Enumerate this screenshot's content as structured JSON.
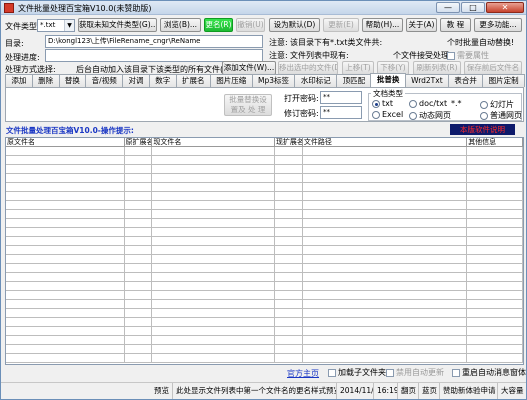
{
  "window": {
    "title": "文件批量处理百宝箱V10.0(未赞助版)",
    "min_glyph": "—",
    "max_glyph": "□",
    "close_glyph": "✕"
  },
  "toolbar": {
    "file_type_label": "文件类型",
    "file_type_value": "*.txt",
    "get_unknown_type_button": "获取未知文件类型(G)...",
    "browse_button": "浏览(B)...",
    "rename_button": "更名(R)",
    "undo_button": "撤销(U)",
    "set_default_button": "设为默认(D)",
    "update_button": "更新(E)",
    "help_button": "帮助(H)...",
    "about_button": "关于(A)",
    "tutorial_button": "教 程",
    "more_button": "更多功能..."
  },
  "dir": {
    "label": "目录:",
    "path": "D:\\kongl123\\上传\\FileRename_cngr\\ReName",
    "progress_label": "处理进度:",
    "note1_label": "注意:",
    "note1_text": "该目录下有*.txt类文件共:",
    "note2_label": "注意:",
    "note2_text": "文件列表中现有:",
    "auto_replace_text": "个时批量自动替换!",
    "files_accepted_text": "个文件接受处理。",
    "keep_attr_label": "需要属性"
  },
  "mode": {
    "label": "处理方式选择:",
    "auto_join_text": "后台自动加入该目录下该类型的所有文件(Y)",
    "add_file_button": "添加文件(W)...",
    "remove_selected_button": "移出选中的文件(D)",
    "move_up_button": "上移(T)",
    "move_down_button": "下移(Y)",
    "refresh_list_button": "刷新列表(R)",
    "save_list_button": "保存前后文件名"
  },
  "tabs": [
    {
      "label": "添加"
    },
    {
      "label": "删除"
    },
    {
      "label": "替换"
    },
    {
      "label": "音/视频"
    },
    {
      "label": "对调"
    },
    {
      "label": "数字"
    },
    {
      "label": "扩展名"
    },
    {
      "label": "图片压缩"
    },
    {
      "label": "Mp3标签"
    },
    {
      "label": "水印标记"
    },
    {
      "label": "顶匹配"
    },
    {
      "label": "批普换"
    },
    {
      "label": "Wrd2Txt"
    },
    {
      "label": "表合并"
    },
    {
      "label": "图片定制"
    }
  ],
  "active_tab_index": 11,
  "panel": {
    "batch_replace_button": "批量替换设置及 处 理",
    "open_password_label": "打开密码:",
    "open_password_value": "**",
    "modify_password_label": "修订密码:",
    "modify_password_value": "**",
    "doc_type_group": "文档类型",
    "radio_txt": "txt",
    "radio_doc": "doc/txt",
    "radio_doc_ext": "*.*",
    "radio_ppt": "幻灯片",
    "radio_excel": "Excel",
    "radio_dynamic": "动态网页",
    "radio_plain": "普通网页"
  },
  "hint": {
    "title": "文件批量处理百宝箱V10.0-操作提示:",
    "link": "本版软件说明"
  },
  "grid": {
    "columns": [
      "原文件名",
      "原扩展名",
      "现文件名",
      "现扩展名",
      "文件路径",
      "其他信息"
    ],
    "row_count": 24
  },
  "bottom": {
    "official_link": "官方主页",
    "include_subfolders": "加载子文件夹",
    "auto_sort": "禁用自动更新",
    "reopen_label": "重启自动消息窗体"
  },
  "status": {
    "preview": "预览",
    "message": "此处显示文件列表中第一个文件名的更名样式预览。",
    "date": "2014/11/1",
    "time": "16:19",
    "lang1": "翻页",
    "lang2": "蓝页",
    "sponsor": "赞助新体验申请",
    "bigfont": "大容量"
  },
  "colors": {
    "rename_green": "#1dbb33",
    "hint_blue": "#1a37c4",
    "link_red": "#ff2a2a",
    "link_bg": "#0d1a6b",
    "official_link": "#1a37c4"
  }
}
